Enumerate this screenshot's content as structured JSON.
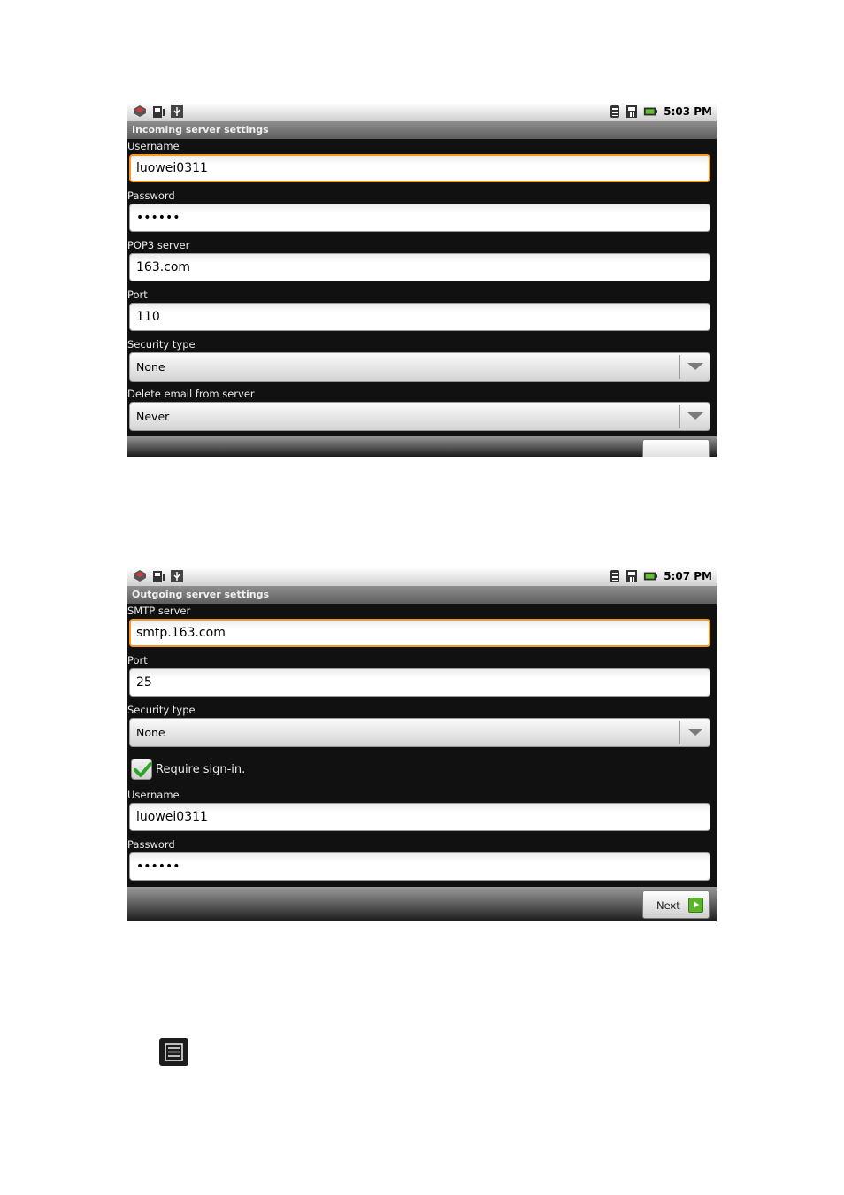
{
  "screen1": {
    "status": {
      "time": "5:03 PM"
    },
    "title": "Incoming server settings",
    "fields": {
      "username_label": "Username",
      "username_value": "luowei0311",
      "password_label": "Password",
      "password_value": "••••••",
      "server_label": "POP3 server",
      "server_value": "163.com",
      "port_label": "Port",
      "port_value": "110",
      "security_label": "Security type",
      "security_value": "None",
      "delete_label": "Delete email from server",
      "delete_value": "Never"
    }
  },
  "screen2": {
    "status": {
      "time": "5:07 PM"
    },
    "title": "Outgoing server settings",
    "fields": {
      "server_label": "SMTP server",
      "server_value": "smtp.163.com",
      "port_label": "Port",
      "port_value": "25",
      "security_label": "Security type",
      "security_value": "None",
      "require_signin_label": "Require sign-in.",
      "require_signin_checked": true,
      "username_label": "Username",
      "username_value": "luowei0311",
      "password_label": "Password",
      "password_value": "••••••"
    },
    "next_label": "Next"
  },
  "icons": {
    "status_left": [
      "alert-icon",
      "sd-card-icon",
      "usb-icon"
    ],
    "status_right": [
      "wifi-icon",
      "signal-icon",
      "battery-charging-icon"
    ],
    "menu": "menu-icon"
  },
  "colors": {
    "focus": "#f39a1e",
    "next_icon": "#5ab52a"
  }
}
